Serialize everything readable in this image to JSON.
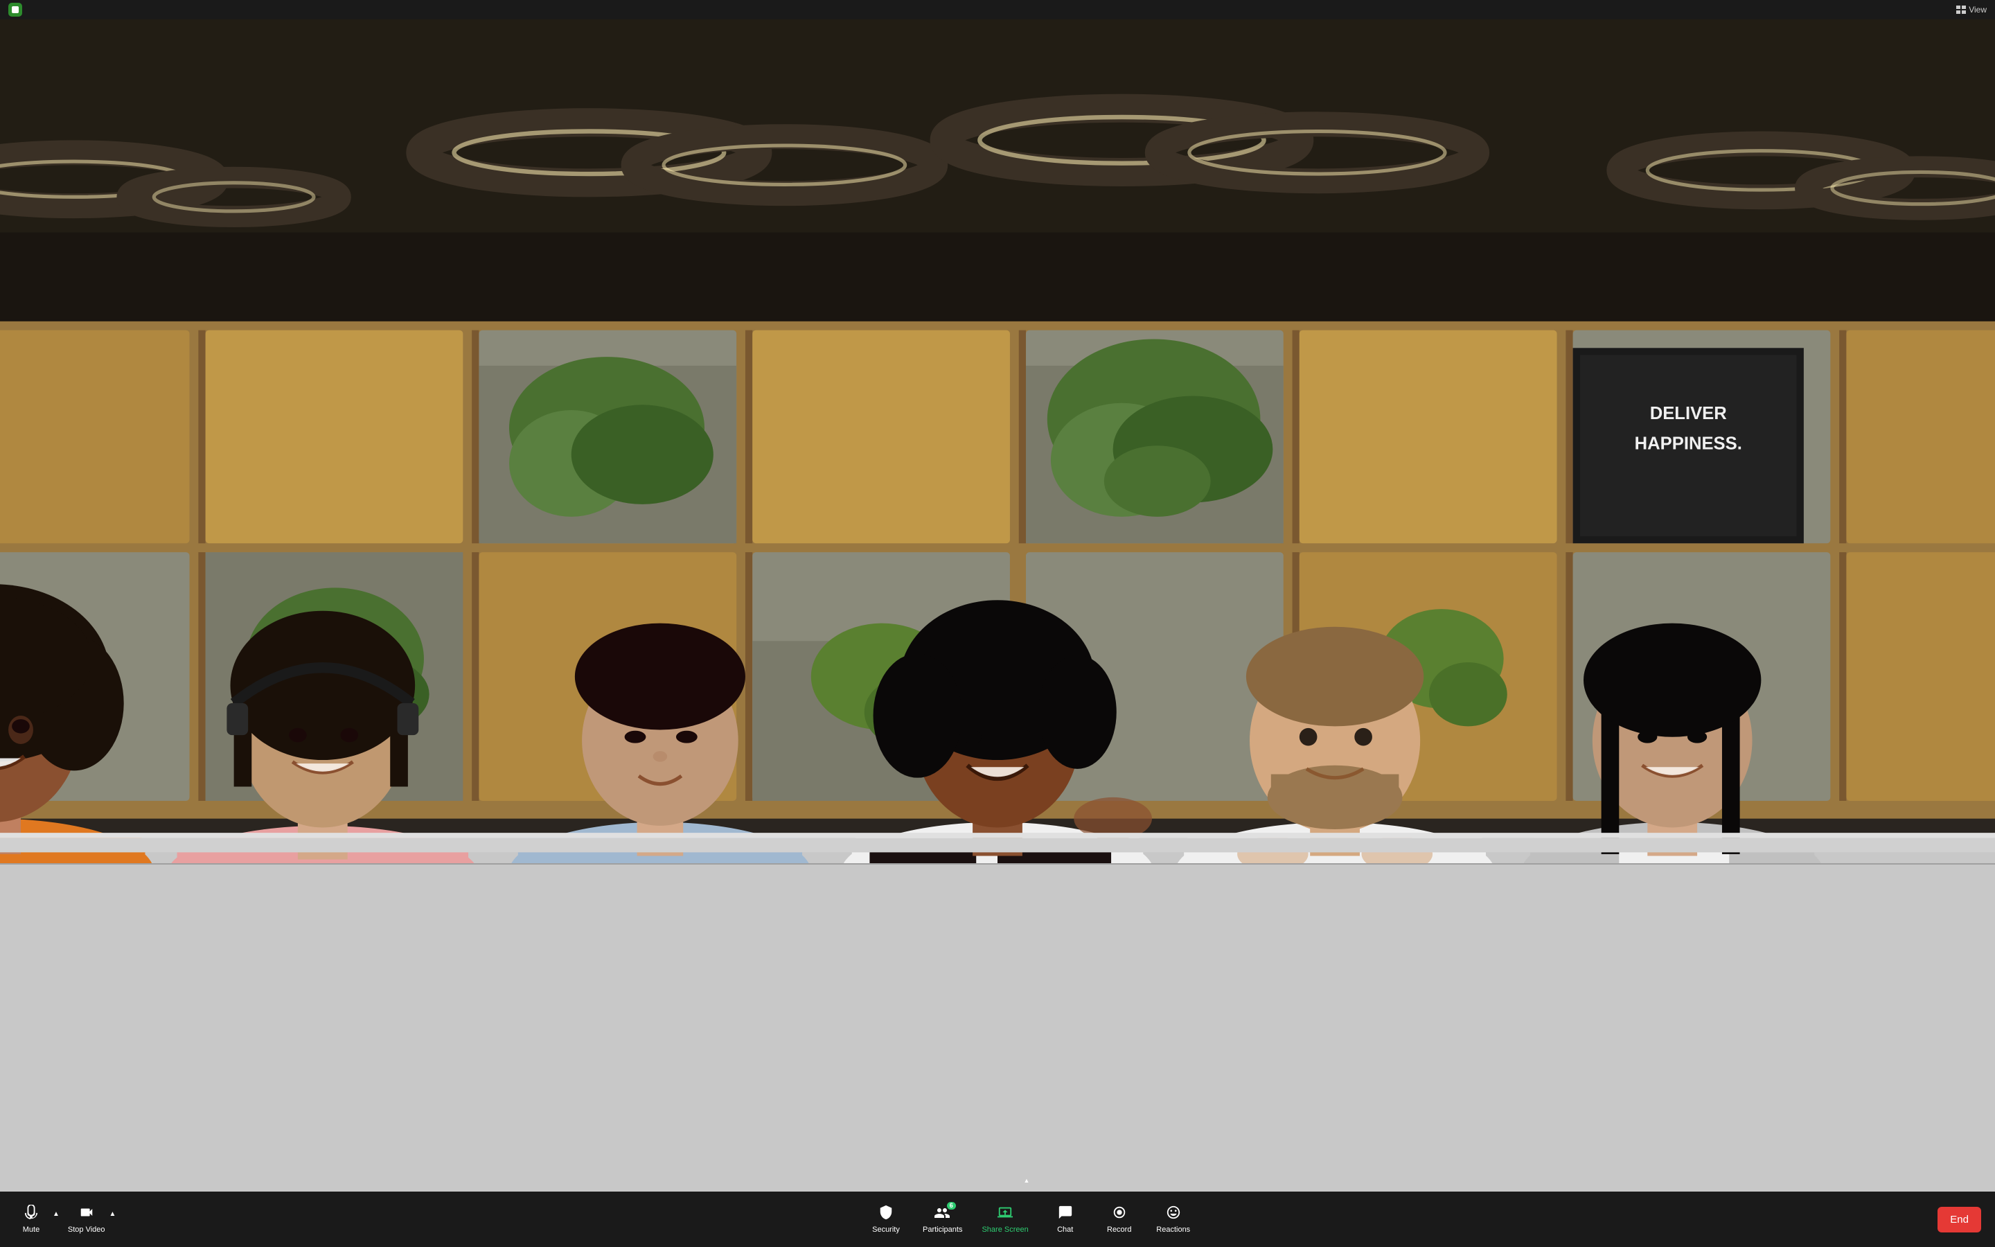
{
  "titleBar": {
    "appIcon": "zoom-icon",
    "viewLabel": "View"
  },
  "toolbar": {
    "muteLabel": "Mute",
    "stopVideoLabel": "Stop Video",
    "securityLabel": "Security",
    "participantsLabel": "Participants",
    "participantsCount": "6",
    "shareScreenLabel": "Share Screen",
    "chatLabel": "Chat",
    "recordLabel": "Record",
    "reactionsLabel": "Reactions",
    "endLabel": "End"
  },
  "scene": {
    "posterText": "DELIVER\nHAPPINESS."
  }
}
